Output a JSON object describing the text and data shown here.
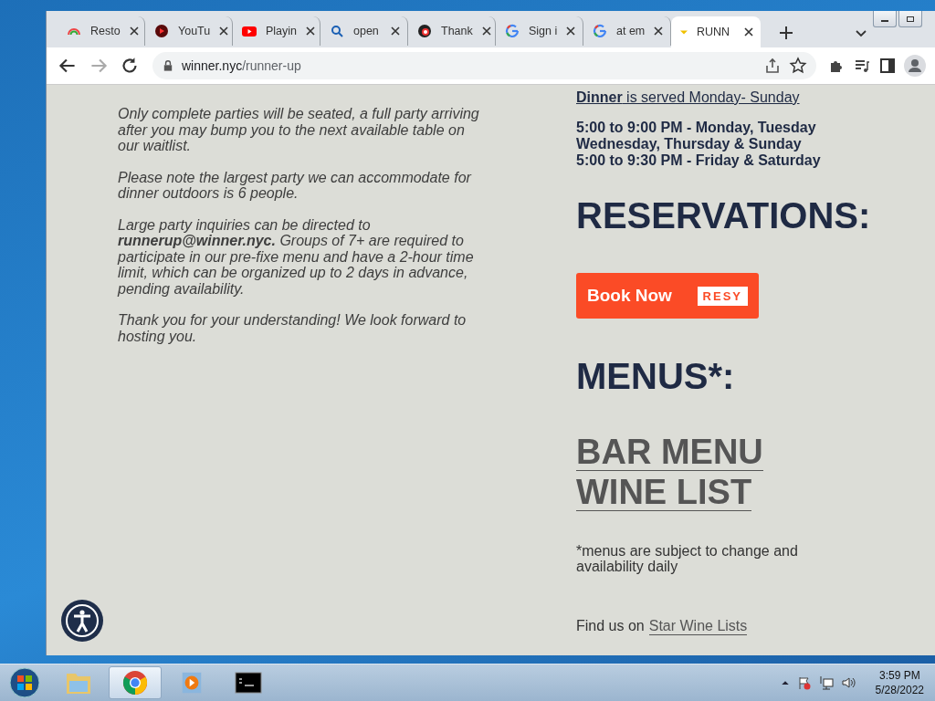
{
  "browser": {
    "tabs": [
      {
        "title": "Resto",
        "kind": "rainbow",
        "selected": false
      },
      {
        "title": "YouTu",
        "kind": "disc",
        "selected": false
      },
      {
        "title": "Playin",
        "kind": "video",
        "selected": false
      },
      {
        "title": "open",
        "kind": "search",
        "selected": false
      },
      {
        "title": "Thank",
        "kind": "badge",
        "selected": false
      },
      {
        "title": "Sign i",
        "kind": "google",
        "selected": false
      },
      {
        "title": "at em",
        "kind": "google",
        "selected": false
      },
      {
        "title": "RUNN",
        "kind": "dot",
        "selected": true
      }
    ],
    "address": {
      "domain": "winner.nyc",
      "path": "/runner-up"
    }
  },
  "page": {
    "left_paragraphs": [
      "Only complete parties will be seated, a full party arriving after you may bump you to the next available table on our waitlist.",
      "Please note the largest party we can accommodate for dinner outdoors is 6 people.",
      "Large party inquiries can be directed to **runnerup@winner.nyc.** Groups of 7+ are required to participate in our pre-fixe menu and have a 2-hour time limit, which can be organized up to 2 days in advance, pending availability.",
      "Thank you for your understanding! We look forward to hosting you."
    ],
    "dinner_line": "**Dinner** is served Monday- Sunday",
    "hours": [
      "5:00 to 9:00 PM - Monday, Tuesday",
      "Wednesday, Thursday & Sunday",
      "5:00 to 9:30 PM - Friday & Saturday"
    ],
    "reservations_heading": "RESERVATIONS:",
    "book_button": {
      "label": "Book Now",
      "badge": "RESY"
    },
    "menus_heading": "MENUS*:",
    "menu_links": [
      "BAR MENU",
      "WINE LIST"
    ],
    "menu_note": "*menus are subject to change and availability daily",
    "find_us": {
      "text": "Find us on",
      "link": "Star Wine Lists"
    }
  },
  "taskbar": {
    "apps": [
      {
        "kind": "folder",
        "selected": false
      },
      {
        "kind": "chrome",
        "selected": true
      },
      {
        "kind": "player",
        "selected": false
      },
      {
        "kind": "terminal",
        "selected": false
      }
    ],
    "clock": {
      "time": "3:59 PM",
      "date": "5/28/2022"
    }
  }
}
